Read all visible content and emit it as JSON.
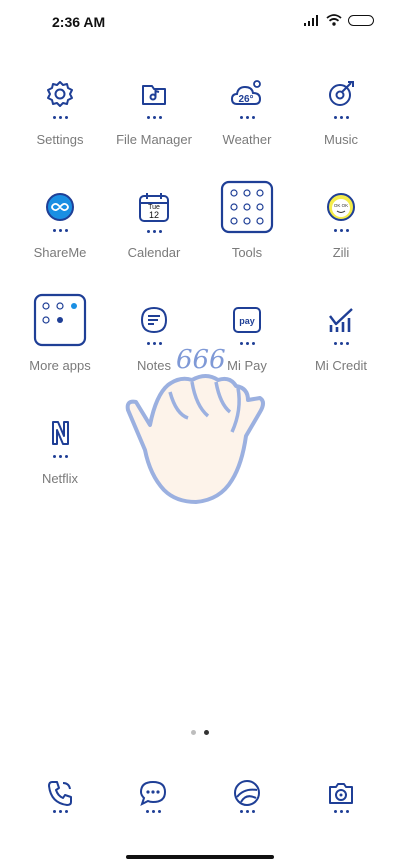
{
  "status": {
    "time": "2:36 AM"
  },
  "apps": [
    {
      "label": "Settings",
      "icon": "gear-icon"
    },
    {
      "label": "File Manager",
      "icon": "folder-icon"
    },
    {
      "label": "Weather",
      "icon": "weather-icon",
      "temp": "26°"
    },
    {
      "label": "Music",
      "icon": "music-icon"
    },
    {
      "label": "ShareMe",
      "icon": "shareme-icon"
    },
    {
      "label": "Calendar",
      "icon": "calendar-icon",
      "day": "Tue",
      "date": "12"
    },
    {
      "label": "Tools",
      "icon": "tools-folder-icon"
    },
    {
      "label": "Zili",
      "icon": "zili-icon",
      "badge": "OK OK"
    },
    {
      "label": "More apps",
      "icon": "more-apps-folder-icon"
    },
    {
      "label": "Notes",
      "icon": "notes-icon"
    },
    {
      "label": "Mi Pay",
      "icon": "mi-pay-icon",
      "badge": "pay"
    },
    {
      "label": "Mi Credit",
      "icon": "mi-credit-icon"
    },
    {
      "label": "Netflix",
      "icon": "netflix-icon"
    }
  ],
  "sticker": {
    "text": "666",
    "icon": "hand-gesture-sticker"
  },
  "dock": [
    {
      "icon": "phone-icon"
    },
    {
      "icon": "messages-icon"
    },
    {
      "icon": "browser-icon"
    },
    {
      "icon": "camera-icon"
    }
  ],
  "colors": {
    "icon_stroke": "#1f3f96",
    "label": "#7a7a7a",
    "sticker_outline": "#9bb0e0"
  }
}
